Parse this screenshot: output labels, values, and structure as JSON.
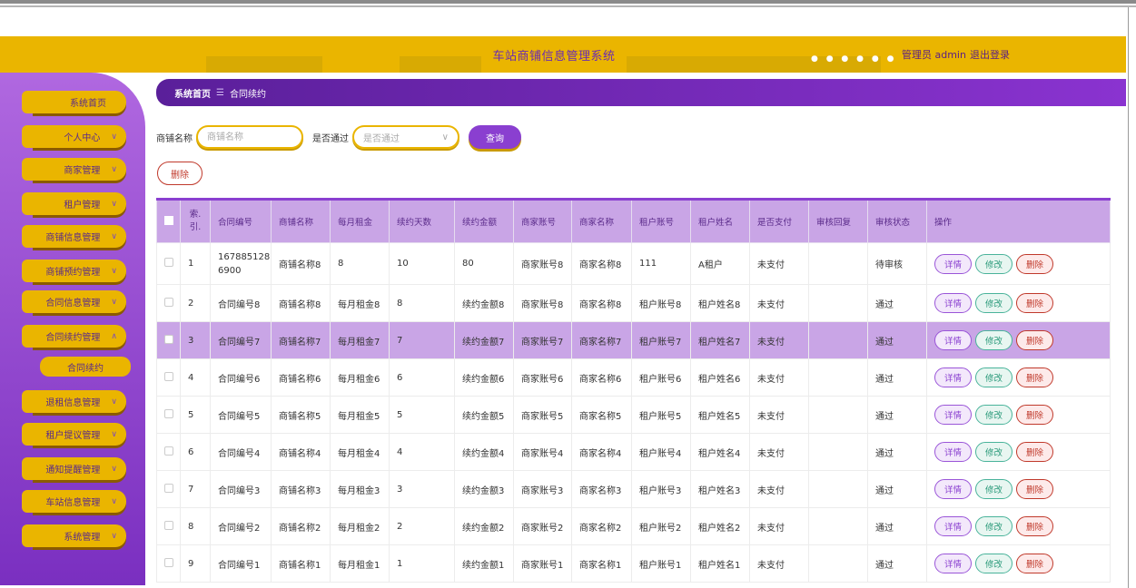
{
  "header": {
    "title": "车站商铺信息管理系统",
    "user_label": "管理员 admin",
    "logout_label": "退出登录",
    "accent": "#eab500",
    "brand_purple": "#8a3fd0"
  },
  "sidebar": {
    "items": [
      {
        "label": "系统首页",
        "has_chevron": false
      },
      {
        "label": "个人中心",
        "has_chevron": true
      },
      {
        "label": "商家管理",
        "has_chevron": true
      },
      {
        "label": "租户管理",
        "has_chevron": true
      },
      {
        "label": "商铺信息管理",
        "has_chevron": true
      },
      {
        "label": "商铺预约管理",
        "has_chevron": true
      },
      {
        "label": "合同信息管理",
        "has_chevron": true
      },
      {
        "label": "合同续约管理",
        "has_chevron": true,
        "expanded": true
      },
      {
        "label": "退租信息管理",
        "has_chevron": true
      },
      {
        "label": "租户提议管理",
        "has_chevron": true
      },
      {
        "label": "通知提醒管理",
        "has_chevron": true
      },
      {
        "label": "车站信息管理",
        "has_chevron": true
      },
      {
        "label": "系统管理",
        "has_chevron": true
      }
    ],
    "sub_item": "合同续约",
    "chevron_down": "∨",
    "chevron_up": "∧"
  },
  "breadcrumb": {
    "home": "系统首页",
    "sep": "☰",
    "current": "合同续约"
  },
  "search": {
    "shop_label": "商铺名称",
    "shop_placeholder": "商铺名称",
    "pass_label": "是否通过",
    "pass_placeholder": "是否通过",
    "query_label": "查询"
  },
  "toolbar": {
    "delete_label": "删除"
  },
  "table": {
    "headers": [
      "索引",
      "合同编号",
      "商铺名称",
      "每月租金",
      "续约天数",
      "续约金额",
      "商家账号",
      "商家名称",
      "租户账号",
      "租户姓名",
      "是否支付",
      "审核回复",
      "审核状态",
      "操作"
    ],
    "index_header_line1": "索.",
    "index_header_line2": "引.",
    "ops": {
      "detail": "详情",
      "edit": "修改",
      "delete": "删除"
    },
    "rows": [
      {
        "idx": "1",
        "contract": "1678851286900",
        "shop": "商铺名称8",
        "rent": "8",
        "days": "10",
        "amount": "80",
        "merchant_acc": "商家账号8",
        "merchant_name": "商家名称8",
        "tenant_acc": "111",
        "tenant_name": "A租户",
        "paid": "未支付",
        "reply": "",
        "status": "待审核"
      },
      {
        "idx": "2",
        "contract": "合同编号8",
        "shop": "商铺名称8",
        "rent": "每月租金8",
        "days": "8",
        "amount": "续约金额8",
        "merchant_acc": "商家账号8",
        "merchant_name": "商家名称8",
        "tenant_acc": "租户账号8",
        "tenant_name": "租户姓名8",
        "paid": "未支付",
        "reply": "",
        "status": "通过"
      },
      {
        "idx": "3",
        "contract": "合同编号7",
        "shop": "商铺名称7",
        "rent": "每月租金7",
        "days": "7",
        "amount": "续约金额7",
        "merchant_acc": "商家账号7",
        "merchant_name": "商家名称7",
        "tenant_acc": "租户账号7",
        "tenant_name": "租户姓名7",
        "paid": "未支付",
        "reply": "",
        "status": "通过"
      },
      {
        "idx": "4",
        "contract": "合同编号6",
        "shop": "商铺名称6",
        "rent": "每月租金6",
        "days": "6",
        "amount": "续约金额6",
        "merchant_acc": "商家账号6",
        "merchant_name": "商家名称6",
        "tenant_acc": "租户账号6",
        "tenant_name": "租户姓名6",
        "paid": "未支付",
        "reply": "",
        "status": "通过"
      },
      {
        "idx": "5",
        "contract": "合同编号5",
        "shop": "商铺名称5",
        "rent": "每月租金5",
        "days": "5",
        "amount": "续约金额5",
        "merchant_acc": "商家账号5",
        "merchant_name": "商家名称5",
        "tenant_acc": "租户账号5",
        "tenant_name": "租户姓名5",
        "paid": "未支付",
        "reply": "",
        "status": "通过"
      },
      {
        "idx": "6",
        "contract": "合同编号4",
        "shop": "商铺名称4",
        "rent": "每月租金4",
        "days": "4",
        "amount": "续约金额4",
        "merchant_acc": "商家账号4",
        "merchant_name": "商家名称4",
        "tenant_acc": "租户账号4",
        "tenant_name": "租户姓名4",
        "paid": "未支付",
        "reply": "",
        "status": "通过"
      },
      {
        "idx": "7",
        "contract": "合同编号3",
        "shop": "商铺名称3",
        "rent": "每月租金3",
        "days": "3",
        "amount": "续约金额3",
        "merchant_acc": "商家账号3",
        "merchant_name": "商家名称3",
        "tenant_acc": "租户账号3",
        "tenant_name": "租户姓名3",
        "paid": "未支付",
        "reply": "",
        "status": "通过"
      },
      {
        "idx": "8",
        "contract": "合同编号2",
        "shop": "商铺名称2",
        "rent": "每月租金2",
        "days": "2",
        "amount": "续约金额2",
        "merchant_acc": "商家账号2",
        "merchant_name": "商家名称2",
        "tenant_acc": "租户账号2",
        "tenant_name": "租户姓名2",
        "paid": "未支付",
        "reply": "",
        "status": "通过"
      },
      {
        "idx": "9",
        "contract": "合同编号1",
        "shop": "商铺名称1",
        "rent": "每月租金1",
        "days": "1",
        "amount": "续约金额1",
        "merchant_acc": "商家账号1",
        "merchant_name": "商家名称1",
        "tenant_acc": "租户账号1",
        "tenant_name": "租户姓名1",
        "paid": "未支付",
        "reply": "",
        "status": "通过"
      }
    ]
  }
}
